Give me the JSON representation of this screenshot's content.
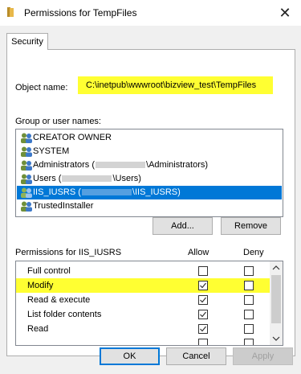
{
  "window": {
    "title": "Permissions for TempFiles",
    "close_glyph": "✕"
  },
  "tabs": [
    {
      "label": "Security"
    }
  ],
  "object": {
    "label": "Object name:",
    "value": "C:\\inetpub\\wwwroot\\bizview_test\\TempFiles"
  },
  "groups": {
    "label": "Group or user names:",
    "items": [
      {
        "name": "CREATOR OWNER",
        "prefix": "",
        "suffix": ""
      },
      {
        "name": "SYSTEM",
        "prefix": "",
        "suffix": ""
      },
      {
        "name": "Administrators",
        "prefix": "Administrators (",
        "suffix": "\\Administrators)"
      },
      {
        "name": "Users",
        "prefix": "Users (",
        "suffix": "\\Users)"
      },
      {
        "name": "IIS_IUSRS",
        "prefix": "IIS_IUSRS (",
        "suffix": "\\IIS_IUSRS)"
      },
      {
        "name": "TrustedInstaller",
        "prefix": "",
        "suffix": ""
      }
    ],
    "selected": "IIS_IUSRS"
  },
  "buttons": {
    "add": "Add...",
    "remove": "Remove",
    "ok": "OK",
    "cancel": "Cancel",
    "apply": "Apply"
  },
  "permissions": {
    "label": "Permissions for IIS_IUSRS",
    "allow_header": "Allow",
    "deny_header": "Deny",
    "rows": [
      {
        "name": "Full control",
        "allow": false,
        "deny": false
      },
      {
        "name": "Modify",
        "allow": true,
        "deny": false
      },
      {
        "name": "Read & execute",
        "allow": true,
        "deny": false
      },
      {
        "name": "List folder contents",
        "allow": true,
        "deny": false
      },
      {
        "name": "Read",
        "allow": true,
        "deny": false
      }
    ]
  },
  "colors": {
    "highlight": "#ffff32",
    "selection": "#0078d7",
    "folder": "#e8b84a"
  },
  "icons": {
    "title": "folder-icon",
    "group": "users-icon",
    "scroll_up": "chevron-up-icon",
    "scroll_down": "chevron-down-icon"
  }
}
